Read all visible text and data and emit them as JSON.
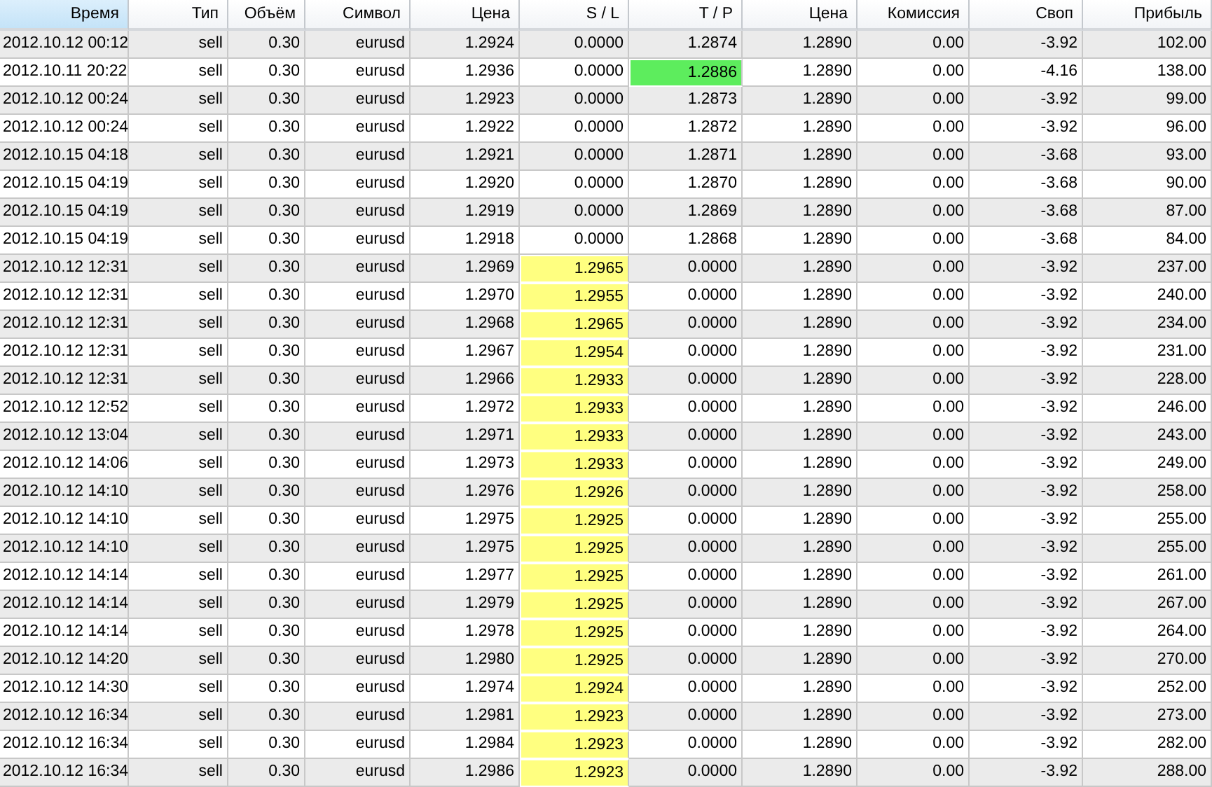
{
  "table": {
    "columns": [
      {
        "label": "Время",
        "sorted": true
      },
      {
        "label": "Тип",
        "sorted": false
      },
      {
        "label": "Объём",
        "sorted": false
      },
      {
        "label": "Символ",
        "sorted": false
      },
      {
        "label": "Цена",
        "sorted": false
      },
      {
        "label": "S / L",
        "sorted": false
      },
      {
        "label": "T / P",
        "sorted": false
      },
      {
        "label": "Цена",
        "sorted": false
      },
      {
        "label": "Комиссия",
        "sorted": false
      },
      {
        "label": "Своп",
        "sorted": false
      },
      {
        "label": "Прибыль",
        "sorted": false
      }
    ],
    "rows": [
      {
        "cells": [
          "2012.10.12 00:12",
          "sell",
          "0.30",
          "eurusd",
          "1.2924",
          "0.0000",
          "1.2874",
          "1.2890",
          "0.00",
          "-3.92",
          "102.00"
        ],
        "sl_marked": false,
        "tp_marked": false
      },
      {
        "cells": [
          "2012.10.11 20:22",
          "sell",
          "0.30",
          "eurusd",
          "1.2936",
          "0.0000",
          "1.2886",
          "1.2890",
          "0.00",
          "-4.16",
          "138.00"
        ],
        "sl_marked": false,
        "tp_marked": true
      },
      {
        "cells": [
          "2012.10.12 00:24",
          "sell",
          "0.30",
          "eurusd",
          "1.2923",
          "0.0000",
          "1.2873",
          "1.2890",
          "0.00",
          "-3.92",
          "99.00"
        ],
        "sl_marked": false,
        "tp_marked": false
      },
      {
        "cells": [
          "2012.10.12 00:24",
          "sell",
          "0.30",
          "eurusd",
          "1.2922",
          "0.0000",
          "1.2872",
          "1.2890",
          "0.00",
          "-3.92",
          "96.00"
        ],
        "sl_marked": false,
        "tp_marked": false
      },
      {
        "cells": [
          "2012.10.15 04:18",
          "sell",
          "0.30",
          "eurusd",
          "1.2921",
          "0.0000",
          "1.2871",
          "1.2890",
          "0.00",
          "-3.68",
          "93.00"
        ],
        "sl_marked": false,
        "tp_marked": false
      },
      {
        "cells": [
          "2012.10.15 04:19",
          "sell",
          "0.30",
          "eurusd",
          "1.2920",
          "0.0000",
          "1.2870",
          "1.2890",
          "0.00",
          "-3.68",
          "90.00"
        ],
        "sl_marked": false,
        "tp_marked": false
      },
      {
        "cells": [
          "2012.10.15 04:19",
          "sell",
          "0.30",
          "eurusd",
          "1.2919",
          "0.0000",
          "1.2869",
          "1.2890",
          "0.00",
          "-3.68",
          "87.00"
        ],
        "sl_marked": false,
        "tp_marked": false
      },
      {
        "cells": [
          "2012.10.15 04:19",
          "sell",
          "0.30",
          "eurusd",
          "1.2918",
          "0.0000",
          "1.2868",
          "1.2890",
          "0.00",
          "-3.68",
          "84.00"
        ],
        "sl_marked": false,
        "tp_marked": false
      },
      {
        "cells": [
          "2012.10.12 12:31",
          "sell",
          "0.30",
          "eurusd",
          "1.2969",
          "1.2965",
          "0.0000",
          "1.2890",
          "0.00",
          "-3.92",
          "237.00"
        ],
        "sl_marked": true,
        "tp_marked": false
      },
      {
        "cells": [
          "2012.10.12 12:31",
          "sell",
          "0.30",
          "eurusd",
          "1.2970",
          "1.2955",
          "0.0000",
          "1.2890",
          "0.00",
          "-3.92",
          "240.00"
        ],
        "sl_marked": true,
        "tp_marked": false
      },
      {
        "cells": [
          "2012.10.12 12:31",
          "sell",
          "0.30",
          "eurusd",
          "1.2968",
          "1.2965",
          "0.0000",
          "1.2890",
          "0.00",
          "-3.92",
          "234.00"
        ],
        "sl_marked": true,
        "tp_marked": false
      },
      {
        "cells": [
          "2012.10.12 12:31",
          "sell",
          "0.30",
          "eurusd",
          "1.2967",
          "1.2954",
          "0.0000",
          "1.2890",
          "0.00",
          "-3.92",
          "231.00"
        ],
        "sl_marked": true,
        "tp_marked": false
      },
      {
        "cells": [
          "2012.10.12 12:31",
          "sell",
          "0.30",
          "eurusd",
          "1.2966",
          "1.2933",
          "0.0000",
          "1.2890",
          "0.00",
          "-3.92",
          "228.00"
        ],
        "sl_marked": true,
        "tp_marked": false
      },
      {
        "cells": [
          "2012.10.12 12:52",
          "sell",
          "0.30",
          "eurusd",
          "1.2972",
          "1.2933",
          "0.0000",
          "1.2890",
          "0.00",
          "-3.92",
          "246.00"
        ],
        "sl_marked": true,
        "tp_marked": false
      },
      {
        "cells": [
          "2012.10.12 13:04",
          "sell",
          "0.30",
          "eurusd",
          "1.2971",
          "1.2933",
          "0.0000",
          "1.2890",
          "0.00",
          "-3.92",
          "243.00"
        ],
        "sl_marked": true,
        "tp_marked": false
      },
      {
        "cells": [
          "2012.10.12 14:06",
          "sell",
          "0.30",
          "eurusd",
          "1.2973",
          "1.2933",
          "0.0000",
          "1.2890",
          "0.00",
          "-3.92",
          "249.00"
        ],
        "sl_marked": true,
        "tp_marked": false
      },
      {
        "cells": [
          "2012.10.12 14:10",
          "sell",
          "0.30",
          "eurusd",
          "1.2976",
          "1.2926",
          "0.0000",
          "1.2890",
          "0.00",
          "-3.92",
          "258.00"
        ],
        "sl_marked": true,
        "tp_marked": false
      },
      {
        "cells": [
          "2012.10.12 14:10",
          "sell",
          "0.30",
          "eurusd",
          "1.2975",
          "1.2925",
          "0.0000",
          "1.2890",
          "0.00",
          "-3.92",
          "255.00"
        ],
        "sl_marked": true,
        "tp_marked": false
      },
      {
        "cells": [
          "2012.10.12 14:10",
          "sell",
          "0.30",
          "eurusd",
          "1.2975",
          "1.2925",
          "0.0000",
          "1.2890",
          "0.00",
          "-3.92",
          "255.00"
        ],
        "sl_marked": true,
        "tp_marked": false
      },
      {
        "cells": [
          "2012.10.12 14:14",
          "sell",
          "0.30",
          "eurusd",
          "1.2977",
          "1.2925",
          "0.0000",
          "1.2890",
          "0.00",
          "-3.92",
          "261.00"
        ],
        "sl_marked": true,
        "tp_marked": false
      },
      {
        "cells": [
          "2012.10.12 14:14",
          "sell",
          "0.30",
          "eurusd",
          "1.2979",
          "1.2925",
          "0.0000",
          "1.2890",
          "0.00",
          "-3.92",
          "267.00"
        ],
        "sl_marked": true,
        "tp_marked": false
      },
      {
        "cells": [
          "2012.10.12 14:14",
          "sell",
          "0.30",
          "eurusd",
          "1.2978",
          "1.2925",
          "0.0000",
          "1.2890",
          "0.00",
          "-3.92",
          "264.00"
        ],
        "sl_marked": true,
        "tp_marked": false
      },
      {
        "cells": [
          "2012.10.12 14:20",
          "sell",
          "0.30",
          "eurusd",
          "1.2980",
          "1.2925",
          "0.0000",
          "1.2890",
          "0.00",
          "-3.92",
          "270.00"
        ],
        "sl_marked": true,
        "tp_marked": false
      },
      {
        "cells": [
          "2012.10.12 14:30",
          "sell",
          "0.30",
          "eurusd",
          "1.2974",
          "1.2924",
          "0.0000",
          "1.2890",
          "0.00",
          "-3.92",
          "252.00"
        ],
        "sl_marked": true,
        "tp_marked": false
      },
      {
        "cells": [
          "2012.10.12 16:34",
          "sell",
          "0.30",
          "eurusd",
          "1.2981",
          "1.2923",
          "0.0000",
          "1.2890",
          "0.00",
          "-3.92",
          "273.00"
        ],
        "sl_marked": true,
        "tp_marked": false
      },
      {
        "cells": [
          "2012.10.12 16:34",
          "sell",
          "0.30",
          "eurusd",
          "1.2984",
          "1.2923",
          "0.0000",
          "1.2890",
          "0.00",
          "-3.92",
          "282.00"
        ],
        "sl_marked": true,
        "tp_marked": false
      },
      {
        "cells": [
          "2012.10.12 16:34",
          "sell",
          "0.30",
          "eurusd",
          "1.2986",
          "1.2923",
          "0.0000",
          "1.2890",
          "0.00",
          "-3.92",
          "288.00"
        ],
        "sl_marked": true,
        "tp_marked": false
      }
    ]
  }
}
